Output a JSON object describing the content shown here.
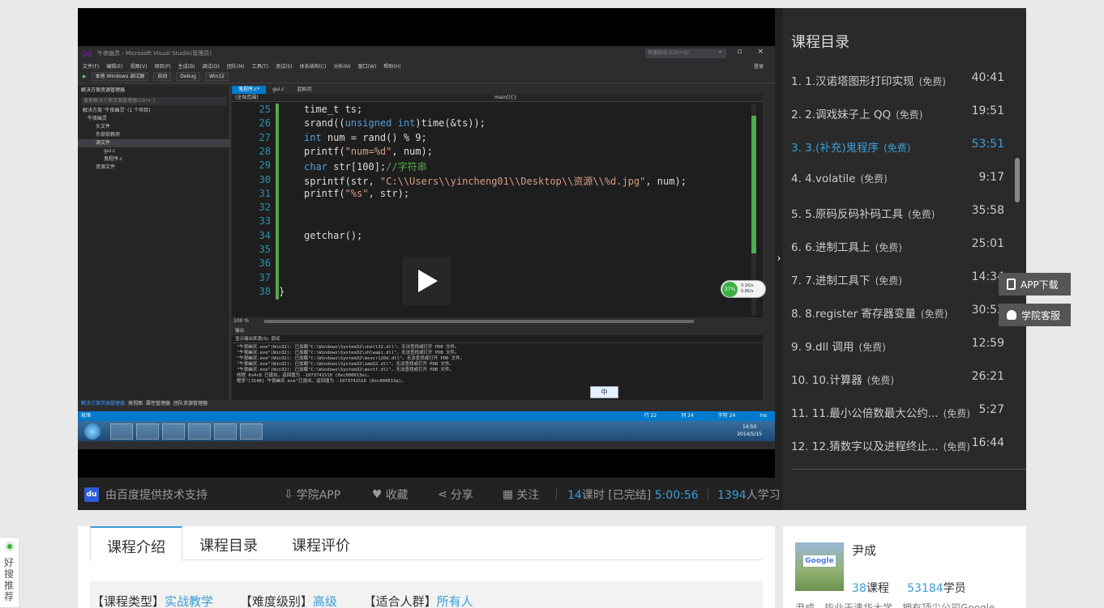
{
  "vs": {
    "window_title": "午夜幽灵 - Microsoft Visual Studio(管理员)",
    "quick_launch": "快速启动 (Ctrl+Q)",
    "menu": [
      "文件(F)",
      "编辑(E)",
      "视图(V)",
      "项目(P)",
      "生成(B)",
      "调试(D)",
      "团队(M)",
      "工具(T)",
      "测试(S)",
      "体系结构(C)",
      "分析(N)",
      "窗口(W)",
      "帮助(H)"
    ],
    "login": "登录",
    "toolbar": {
      "debugger": "本地 Windows 调试器",
      "auto": "自动",
      "config": "Debug",
      "platform": "Win32"
    },
    "solution_panel_title": "解决方案资源管理器",
    "solution_search": "搜索解决方案资源管理器(Ctrl+;)",
    "solution_tree": [
      "解决方案 '午夜幽灵' (1 个项目)",
      "午夜幽灵",
      "头文件",
      "外部依赖项",
      "源文件",
      "gui.c",
      "鬼程序.c",
      "资源文件"
    ],
    "editor_tabs": [
      "鬼程序.c*",
      "gui.c",
      "起始页"
    ],
    "scope_left": "(全局范围)",
    "scope_right": "main(){}",
    "zoom": "100 %",
    "output_title": "输出",
    "output_source_label": "显示输出来源(S):",
    "output_source_value": "调试",
    "output_lines": [
      "\"午夜幽灵.exe\"(Win32): 已加载\"C:\\Windows\\System32\\shell32.dll\"。无法查找或打开 PDB 文件。",
      "\"午夜幽灵.exe\"(Win32): 已加载\"C:\\Windows\\System32\\shlwapi.dll\"。无法查找或打开 PDB 文件。",
      "\"午夜幽灵.exe\"(Win32): 已加载\"C:\\Windows\\System32\\msvcr120d.dll\"。无法查找或打开 PDB 文件。",
      "\"午夜幽灵.exe\"(Win32): 已加载\"C:\\Windows\\System32\\imm32.dll\"。无法查找或打开 PDB 文件。",
      "\"午夜幽灵.exe\"(Win32): 已加载\"C:\\Windows\\System32\\msctf.dll\"。无法查找或打开 PDB 文件。",
      "线程 0x4c8 已退出，返回值为 -1073741510 (0xc000013a)。",
      "程序\"[3148] 午夜幽灵.exe\"已退出，返回值为 -1073741510 (0xc000013a)。"
    ],
    "ime": "中",
    "solution_tabs": [
      "解决方案资源管理器",
      "类视图",
      "属性管理器",
      "团队资源管理器"
    ],
    "status_left": "就绪",
    "status_row": "行 22",
    "status_col": "列 24",
    "status_ch": "字符 24",
    "status_ins": "Ins",
    "clock_time": "14:50",
    "clock_date": "2014/5/15",
    "gauge_pct": "37%",
    "gauge_up": "0.1K/s",
    "gauge_down": "0.8K/s",
    "code_lines": [
      {
        "n": "25",
        "parts": [
          [
            "",
            "time_t ts;"
          ]
        ]
      },
      {
        "n": "26",
        "parts": [
          [
            "",
            "srand(("
          ],
          [
            "kw",
            "unsigned int"
          ],
          [
            "",
            ")time(&ts));"
          ]
        ]
      },
      {
        "n": "27",
        "parts": [
          [
            "kw",
            "int"
          ],
          [
            "",
            " num = rand() % 9;"
          ]
        ]
      },
      {
        "n": "28",
        "parts": [
          [
            "",
            "printf("
          ],
          [
            "str",
            "\"num=%d\""
          ],
          [
            "",
            ", num);"
          ]
        ]
      },
      {
        "n": "29",
        "parts": [
          [
            "kw",
            "char"
          ],
          [
            "",
            " str[100];"
          ],
          [
            "cm",
            "//字符串"
          ]
        ]
      },
      {
        "n": "30",
        "parts": [
          [
            "",
            "sprintf(str, "
          ],
          [
            "str",
            "\"C:\\\\Users\\\\yincheng01\\\\Desktop\\\\资源\\\\%d.jpg\""
          ],
          [
            "",
            ", num);"
          ]
        ]
      },
      {
        "n": "31",
        "parts": [
          [
            "",
            "printf("
          ],
          [
            "str",
            "\"%s\""
          ],
          [
            "",
            ", str);"
          ]
        ]
      },
      {
        "n": "32",
        "parts": []
      },
      {
        "n": "33",
        "parts": []
      },
      {
        "n": "34",
        "parts": [
          [
            "",
            "getchar();"
          ]
        ]
      },
      {
        "n": "35",
        "parts": []
      },
      {
        "n": "36",
        "parts": []
      },
      {
        "n": "37",
        "parts": []
      },
      {
        "n": "38",
        "parts": [
          [
            "",
            "}"
          ]
        ]
      }
    ]
  },
  "controlbar": {
    "baidu": "由百度提供技术支持",
    "app": "学院APP",
    "fav": "收藏",
    "share": "分享",
    "follow": "关注",
    "lessons_count": "14",
    "lessons_label": "课时",
    "status": "[已完结]",
    "duration": "5:00:56",
    "learners": "1394",
    "learners_label": "人学习"
  },
  "playlist": {
    "title": "课程目录",
    "free_label": "(免费)",
    "items": [
      {
        "title": "1. 1.汉诺塔图形打印实现",
        "duration": "40:41",
        "current": false
      },
      {
        "title": "2. 2.调戏妹子上 QQ",
        "duration": "19:51",
        "current": false
      },
      {
        "title": "3. 3.(补充)鬼程序",
        "duration": "53:51",
        "current": true
      },
      {
        "title": "4. 4.volatile",
        "duration": "9:17",
        "current": false
      },
      {
        "title": "5. 5.原码反码补码工具",
        "duration": "35:58",
        "current": false
      },
      {
        "title": "6. 6.进制工具上",
        "duration": "25:01",
        "current": false
      },
      {
        "title": "7. 7.进制工具下",
        "duration": "14:34",
        "current": false
      },
      {
        "title": "8. 8.register 寄存器变量",
        "duration": "30:52",
        "current": false
      },
      {
        "title": "9. 9.dll 调用",
        "duration": "12:59",
        "current": false
      },
      {
        "title": "10. 10.计算器",
        "duration": "26:21",
        "current": false
      },
      {
        "title": "11. 11.最小公倍数最大公约...",
        "duration": "5:27",
        "current": false
      },
      {
        "title": "12. 12.猜数字以及进程终止...",
        "duration": "16:44",
        "current": false
      }
    ]
  },
  "float": {
    "app": "APP下载",
    "service": "学院客服"
  },
  "intro": {
    "tabs": [
      "课程介绍",
      "课程目录",
      "课程评价"
    ],
    "type_label": "【课程类型】",
    "type_value": "实战教学",
    "level_label": "【难度级别】",
    "level_value": "高级",
    "audience_label": "【适合人群】",
    "audience_value": "所有人"
  },
  "teacher": {
    "name": "尹成",
    "photo_sign": "Google",
    "courses": "38",
    "courses_label": "课程",
    "students": "53184",
    "students_label": "学员",
    "bio": "尹成，毕业于清华大学，拥有顶尖公司Google"
  },
  "side_rec": {
    "text": "好搜推荐"
  }
}
